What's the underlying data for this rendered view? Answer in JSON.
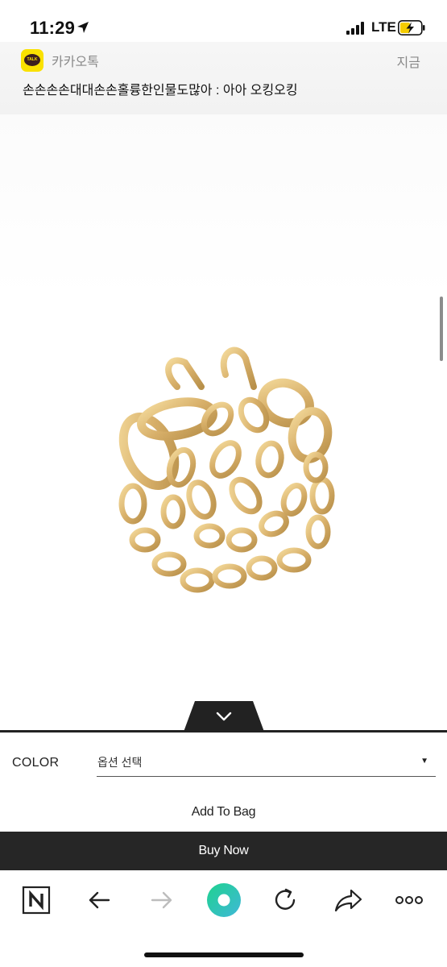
{
  "status_bar": {
    "time": "11:29",
    "network": "LTE"
  },
  "notification": {
    "app_name": "카카오톡",
    "app_icon_text": "TALK",
    "time": "지금",
    "message": "손손손손대대손손홀륭한인물도많아 : 아아 오킹오킹"
  },
  "product": {
    "image_description_icon": "gold-chain-strap-image"
  },
  "options": {
    "color_label": "COLOR",
    "select_value": "옵션 선택",
    "caret": "▼"
  },
  "actions": {
    "add_to_bag": "Add To Bag",
    "buy_now": "Buy Now"
  },
  "toolbar": {
    "icons": [
      "naver-n-icon",
      "back-arrow-icon",
      "forward-arrow-icon",
      "green-home-icon",
      "refresh-icon",
      "share-icon",
      "more-icon"
    ]
  },
  "colors": {
    "buy_now_bg": "#262626",
    "kakao_yellow": "#fae100",
    "naver_green": "#2bd6a0"
  }
}
